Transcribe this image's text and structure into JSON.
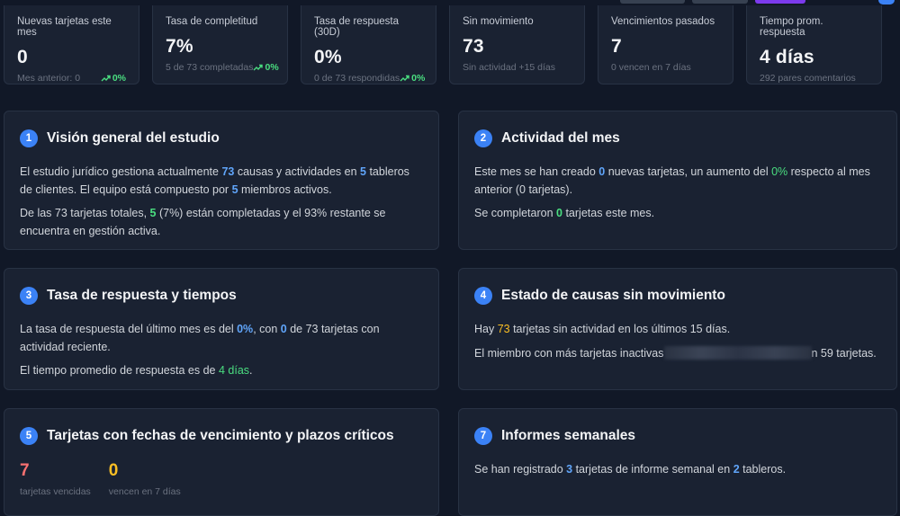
{
  "stats": [
    {
      "label": "Nuevas tarjetas este mes",
      "value": "0",
      "sub": "Mes anterior: 0",
      "trend": "0%"
    },
    {
      "label": "Tasa de completitud",
      "value": "7%",
      "sub": "5 de 73 completadas",
      "trend": "0%"
    },
    {
      "label": "Tasa de respuesta (30D)",
      "value": "0%",
      "sub": "0 de 73 respondidas",
      "trend": "0%"
    },
    {
      "label": "Sin movimiento",
      "value": "73",
      "sub": "Sin actividad +15 días"
    },
    {
      "label": "Vencimientos pasados",
      "value": "7",
      "sub": "0 vencen en 7 días"
    },
    {
      "label": "Tiempo prom. respuesta",
      "value": "4 días",
      "sub": "292 pares comentarios"
    }
  ],
  "sections": {
    "s1": {
      "num": "1",
      "title": "Visión general del estudio",
      "p1": {
        "a": "El estudio jurídico gestiona actualmente ",
        "v1": "73",
        "b": " causas y actividades en ",
        "v2": "5",
        "c": " tableros de clientes. El equipo está compuesto por ",
        "v3": "5",
        "d": " miembros activos."
      },
      "p2": {
        "a": "De las 73 tarjetas totales, ",
        "v1": "5",
        "b": " (7%) están completadas y el 93% restante se encuentra en gestión activa."
      }
    },
    "s2": {
      "num": "2",
      "title": "Actividad del mes",
      "p1": {
        "a": "Este mes se han creado ",
        "v1": "0",
        "b": " nuevas tarjetas, un aumento del ",
        "v2": "0%",
        "c": " respecto al mes anterior (0 tarjetas)."
      },
      "p2": {
        "a": "Se completaron ",
        "v1": "0",
        "b": " tarjetas este mes."
      }
    },
    "s3": {
      "num": "3",
      "title": "Tasa de respuesta y tiempos",
      "p1": {
        "a": "La tasa de respuesta del último mes es del ",
        "v1": "0%",
        "b": ", con ",
        "v2": "0",
        "c": " de 73 tarjetas con actividad reciente."
      },
      "p2": {
        "a": "El tiempo promedio de respuesta es de ",
        "v1": "4 días",
        "b": "."
      }
    },
    "s4": {
      "num": "4",
      "title": "Estado de causas sin movimiento",
      "p1": {
        "a": "Hay ",
        "v1": "73",
        "b": " tarjetas sin actividad en los últimos 15 días."
      },
      "p2": {
        "a": "El miembro con más tarjetas inactivas",
        "b": "n 59 tarjetas."
      }
    },
    "s5": {
      "num": "5",
      "title": "Tarjetas con fechas de vencimiento y plazos críticos",
      "overdue": {
        "value": "7",
        "label": "tarjetas vencidas"
      },
      "soon": {
        "value": "0",
        "label": "vencen en 7 días"
      }
    },
    "s7": {
      "num": "7",
      "title": "Informes semanales",
      "p1": {
        "a": "Se han registrado ",
        "v1": "3",
        "b": " tarjetas de informe semanal en ",
        "v2": "2",
        "c": " tableros."
      }
    }
  },
  "colors": {
    "accent": "#3b82f6",
    "positive": "#4ade80",
    "warning": "#fbbf24",
    "danger": "#f87171"
  }
}
